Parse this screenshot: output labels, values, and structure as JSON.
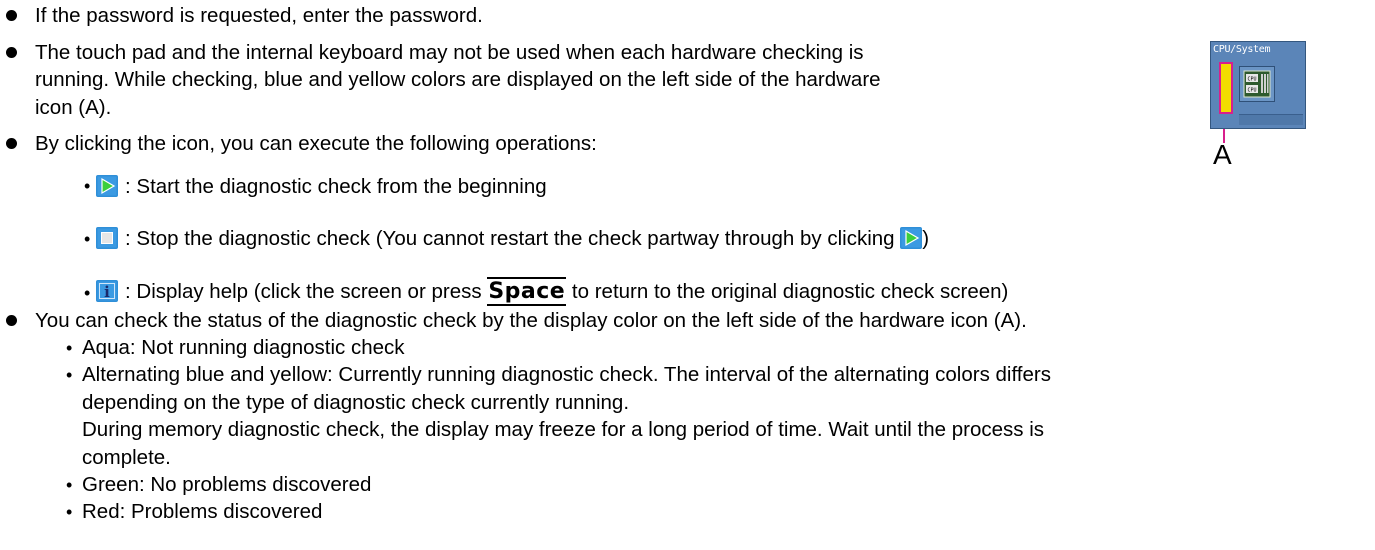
{
  "bullets": {
    "b1": "If the password is requested, enter the password.",
    "b2_l1": "The touch pad and the internal keyboard may not be used when each hardware checking is",
    "b2_l2": "running. While checking, blue and yellow colors are displayed on the left side of the hardware",
    "b2_l3": "icon (A).",
    "b3": "By clicking the icon, you can execute the following operations:",
    "b4": "You can check the status of the diagnostic check by the display color on the left side of the hardware icon (A)."
  },
  "operations": {
    "start": ": Start the diagnostic check from the beginning",
    "stop_pre": ": Stop the diagnostic check (You cannot restart the check partway through by clicking",
    "stop_post": ")",
    "help_pre": ": Display help (click the screen or press",
    "help_key": "Space",
    "help_post": "to return to the original diagnostic check screen)"
  },
  "statuses": {
    "aqua": "Aqua: Not running diagnostic check",
    "alt_l1": "Alternating blue and yellow: Currently running diagnostic check. The interval of the alternating colors differs",
    "alt_l2": "depending on the type of diagnostic check currently running.",
    "alt_l3": "During memory diagnostic check, the display may freeze for a long period of time. Wait until the process is",
    "alt_l4": "complete.",
    "green": "Green: No problems discovered",
    "red": "Red: Problems discovered"
  },
  "figure": {
    "title": "CPU/System",
    "label": "A",
    "chip_text_1": "CPU",
    "chip_text_2": "CPU"
  },
  "icons": {
    "start": "play-icon",
    "stop": "stop-icon",
    "help": "info-icon"
  },
  "colors": {
    "icon_blue": "#2f8fd8",
    "play_green": "#3ccf3c",
    "status_bar_yellow": "#f2dd00",
    "pointer_magenta": "#d81f8c"
  }
}
